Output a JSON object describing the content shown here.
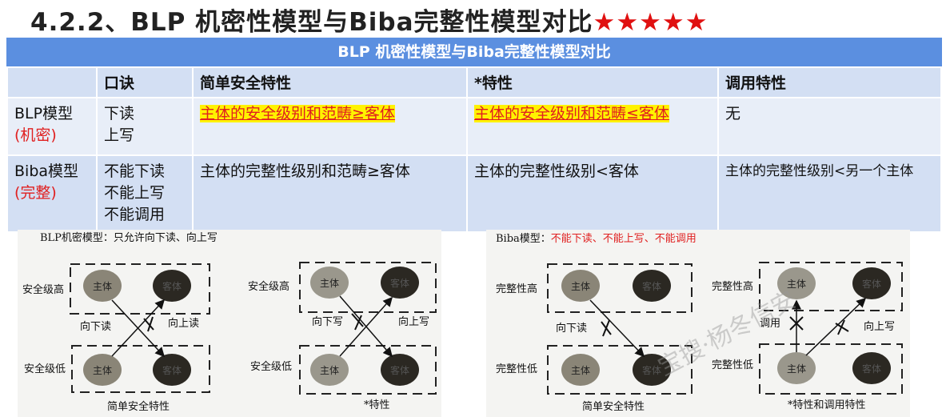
{
  "title": {
    "text": "4.2.2、BLP 机密性模型与Biba完整性模型对比",
    "stars": "★★★★★"
  },
  "table": {
    "caption": "BLP 机密性模型与Biba完整性模型对比",
    "headers": [
      "",
      "口诀",
      "简单安全特性",
      "*特性",
      "调用特性"
    ],
    "rows": [
      {
        "model": "BLP模型",
        "tag": "(机密)",
        "mnemonic": [
          "下读",
          "上写"
        ],
        "simple": "主体的安全级别和范畴≥客体",
        "star": "主体的安全级别和范畴≤客体",
        "invoke": "无"
      },
      {
        "model": "Biba模型",
        "tag": "(完整)",
        "mnemonic": [
          "不能下读",
          "不能上写",
          "不能调用"
        ],
        "simple": "主体的完整性级别和范畴≥客体",
        "star": "主体的完整性级别<客体",
        "invoke": "主体的完整性级别<另一个主体"
      }
    ]
  },
  "blp_figure": {
    "title": "BLP机密模型：只允许向下读、向上写",
    "high": "安全级高",
    "low": "安全级低",
    "subject": "主体",
    "object": "客体",
    "read_down": "向下读",
    "read_up": "向上读",
    "write_down": "向下写",
    "write_up": "向上写",
    "caption_simple": "简单安全特性",
    "caption_star": "*特性"
  },
  "biba_figure": {
    "title_prefix": "Biba模型：",
    "title_rule": "不能下读、不能上写、不能调用",
    "high": "完整性高",
    "low": "完整性低",
    "subject": "主体",
    "object": "客体",
    "read_down": "向下读",
    "invoke": "调用",
    "write_up": "向上写",
    "caption_simple": "简单安全特性",
    "caption_star": "*特性和调用特性"
  },
  "watermark": "宝搜·杨冬信安"
}
